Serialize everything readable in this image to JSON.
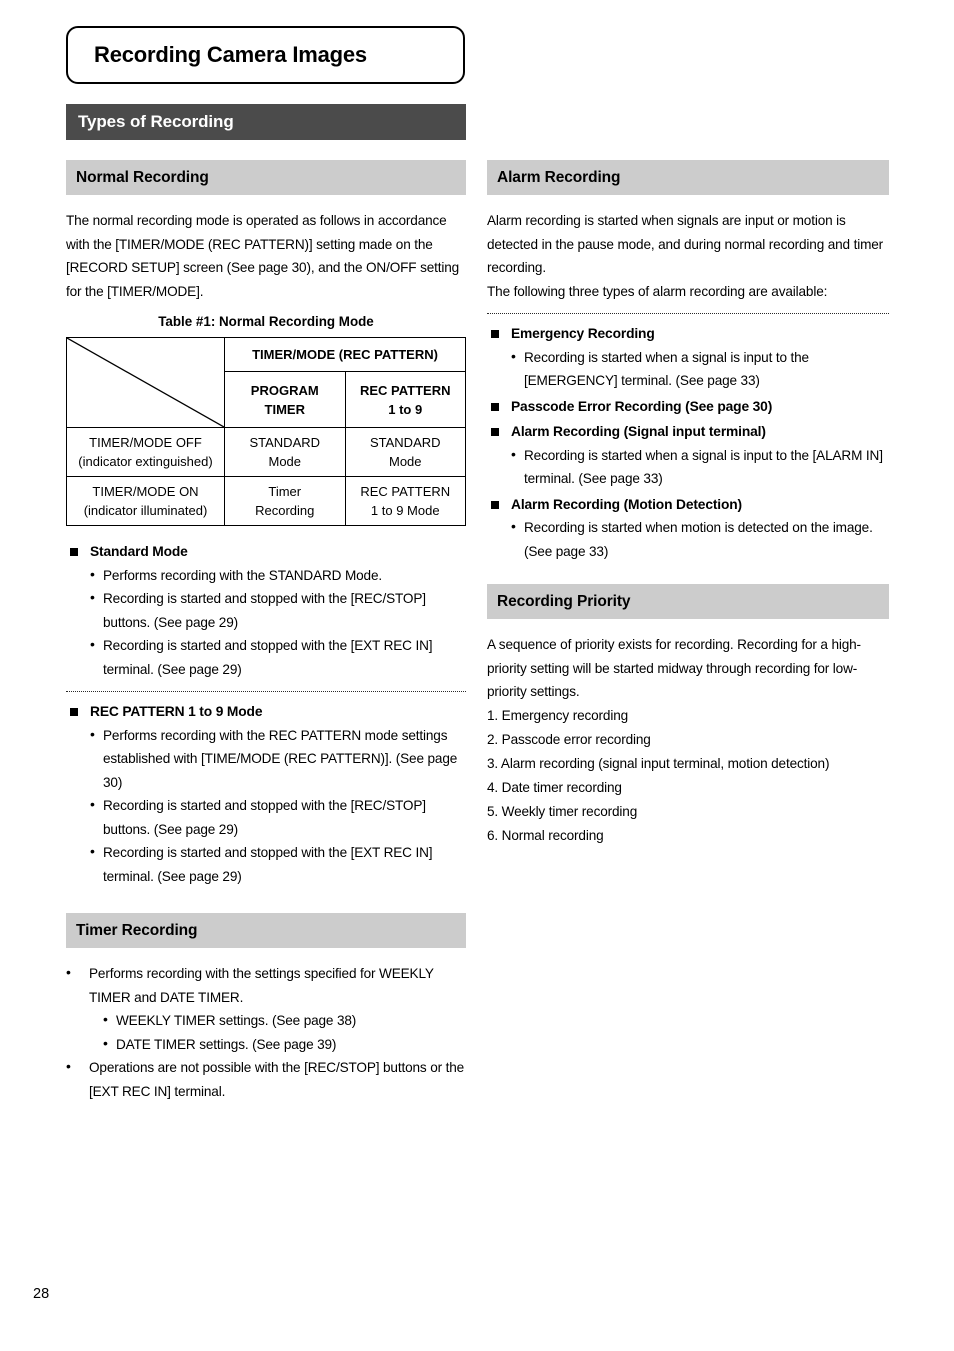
{
  "page": {
    "chapter_title": "Recording Camera Images",
    "section_bar": "Types of Recording",
    "page_number": "28"
  },
  "left": {
    "normal_recording": {
      "header": "Normal Recording",
      "paragraph": "The normal recording mode is operated as follows in accordance with the [TIMER/MODE (REC PATTERN)] setting made on the [RECORD SETUP] screen (See page 30), and the ON/OFF setting for the [TIMER/MODE].",
      "table_caption": "Table #1: Normal Recording Mode",
      "table": {
        "col_group_header": "TIMER/MODE (REC PATTERN)",
        "col_headers": [
          "PROGRAM TIMER",
          "REC PATTERN 1 to 9"
        ],
        "col_headers_split": [
          [
            "PROGRAM",
            "TIMER"
          ],
          [
            "REC PATTERN",
            "1 to 9"
          ]
        ],
        "rows": [
          {
            "label": [
              "TIMER/MODE OFF",
              "(indicator extinguished)"
            ],
            "cells": [
              [
                "STANDARD",
                "Mode"
              ],
              [
                "STANDARD",
                "Mode"
              ]
            ]
          },
          {
            "label": [
              "TIMER/MODE ON",
              "(indicator illuminated)"
            ],
            "cells": [
              [
                "Timer",
                "Recording"
              ],
              [
                "REC PATTERN",
                "1 to 9 Mode"
              ]
            ]
          }
        ]
      },
      "standard_mode": {
        "heading": "Standard Mode",
        "bullets": [
          "Performs recording with the STANDARD Mode.",
          "Recording is started and stopped with the [REC/STOP] buttons. (See page 29)",
          "Recording is started and stopped with the [EXT REC IN] terminal. (See page 29)"
        ]
      },
      "rec_pattern_mode": {
        "heading": "REC PATTERN 1 to 9 Mode",
        "bullets": [
          "Performs recording with the REC PATTERN mode settings established with [TIME/MODE (REC PATTERN)]. (See page 30)",
          "Recording is started and stopped with the [REC/STOP] buttons. (See page 29)",
          "Recording is started and stopped with the [EXT REC IN] terminal. (See page 29)"
        ]
      }
    },
    "timer_recording": {
      "header": "Timer Recording",
      "bullets": [
        "Performs recording with the settings specified for WEEKLY TIMER and DATE TIMER.",
        "Operations are not possible with the [REC/STOP] buttons or the [EXT REC IN] terminal."
      ],
      "sub_bullets": [
        "WEEKLY TIMER settings. (See page 38)",
        "DATE TIMER settings. (See page 39)"
      ]
    }
  },
  "right": {
    "alarm_recording": {
      "header": "Alarm Recording",
      "paragraph1": "Alarm recording is started when signals are input or motion is detected in the pause mode, and during normal recording and timer recording.",
      "paragraph2": "The following three types of alarm recording are available:",
      "groups": [
        {
          "heading": "Emergency Recording",
          "bullets": [
            "Recording is started when a signal is input to the [EMERGENCY] terminal. (See page 33)"
          ]
        },
        {
          "heading": "Passcode Error Recording (See page 30)",
          "bullets": []
        },
        {
          "heading": "Alarm Recording (Signal input terminal)",
          "bullets": [
            "Recording is started when a signal is input to the [ALARM IN] terminal. (See page 33)"
          ]
        },
        {
          "heading": "Alarm Recording (Motion Detection)",
          "bullets": [
            "Recording is started when motion is detected on the image. (See page 33)"
          ]
        }
      ]
    },
    "recording_priority": {
      "header": "Recording Priority",
      "paragraph": "A sequence of priority exists for recording. Recording for a high-priority setting will be started midway through recording for low-priority settings.",
      "items": [
        "1. Emergency recording",
        "2. Passcode error recording",
        "3. Alarm recording (signal input terminal, motion detection)",
        "4. Date timer recording",
        "5. Weekly timer recording",
        "6. Normal recording"
      ]
    }
  },
  "colors": {
    "section_bar_bg": "#4b4b4b",
    "subsection_bg": "#cccccc",
    "text": "#000000"
  }
}
